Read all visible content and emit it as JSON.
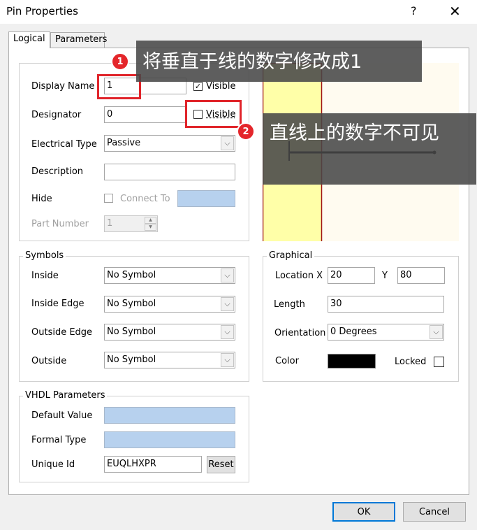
{
  "window": {
    "title": "Pin Properties",
    "help_label": "?",
    "close_label": "✕"
  },
  "tabs": [
    {
      "label": "Logical",
      "active": true
    },
    {
      "label": "Parameters",
      "active": false
    }
  ],
  "logical": {
    "display_name": {
      "label": "Display Name",
      "value": "1",
      "visible_label": "Visible",
      "visible_checked": true
    },
    "designator": {
      "label": "Designator",
      "value": "0",
      "visible_label": "Visible",
      "visible_checked": false
    },
    "electrical_type": {
      "label": "Electrical Type",
      "value": "Passive"
    },
    "description": {
      "label": "Description",
      "value": ""
    },
    "hide": {
      "label": "Hide",
      "connect_to_label": "Connect To",
      "checked": false,
      "value": ""
    },
    "part_number": {
      "label": "Part Number",
      "value": "1"
    }
  },
  "symbols": {
    "group_label": "Symbols",
    "inside": {
      "label": "Inside",
      "value": "No Symbol"
    },
    "inside_edge": {
      "label": "Inside Edge",
      "value": "No Symbol"
    },
    "outside_edge": {
      "label": "Outside Edge",
      "value": "No Symbol"
    },
    "outside": {
      "label": "Outside",
      "value": "No Symbol"
    }
  },
  "graphical": {
    "group_label": "Graphical",
    "location_x_label": "Location X",
    "location_x": "20",
    "location_y_label": "Y",
    "location_y": "80",
    "length_label": "Length",
    "length": "30",
    "orientation_label": "Orientation",
    "orientation": "0 Degrees",
    "color_label": "Color",
    "color": "#000000",
    "locked_label": "Locked",
    "locked": false
  },
  "vhdl": {
    "group_label": "VHDL Parameters",
    "default_value_label": "Default Value",
    "default_value": "",
    "formal_type_label": "Formal Type",
    "formal_type": "",
    "unique_id_label": "Unique Id",
    "unique_id": "EUQLHXPR",
    "reset_label": "Reset"
  },
  "buttons": {
    "ok": "OK",
    "cancel": "Cancel"
  },
  "annotations": [
    {
      "number": "1",
      "text": "将垂直于线的数字修改成1"
    },
    {
      "number": "2",
      "text": "直线上的数字不可见"
    }
  ],
  "preview": {
    "body_color": "#ffffa8",
    "body_border": "#a01414",
    "background": "#fffbf0"
  }
}
